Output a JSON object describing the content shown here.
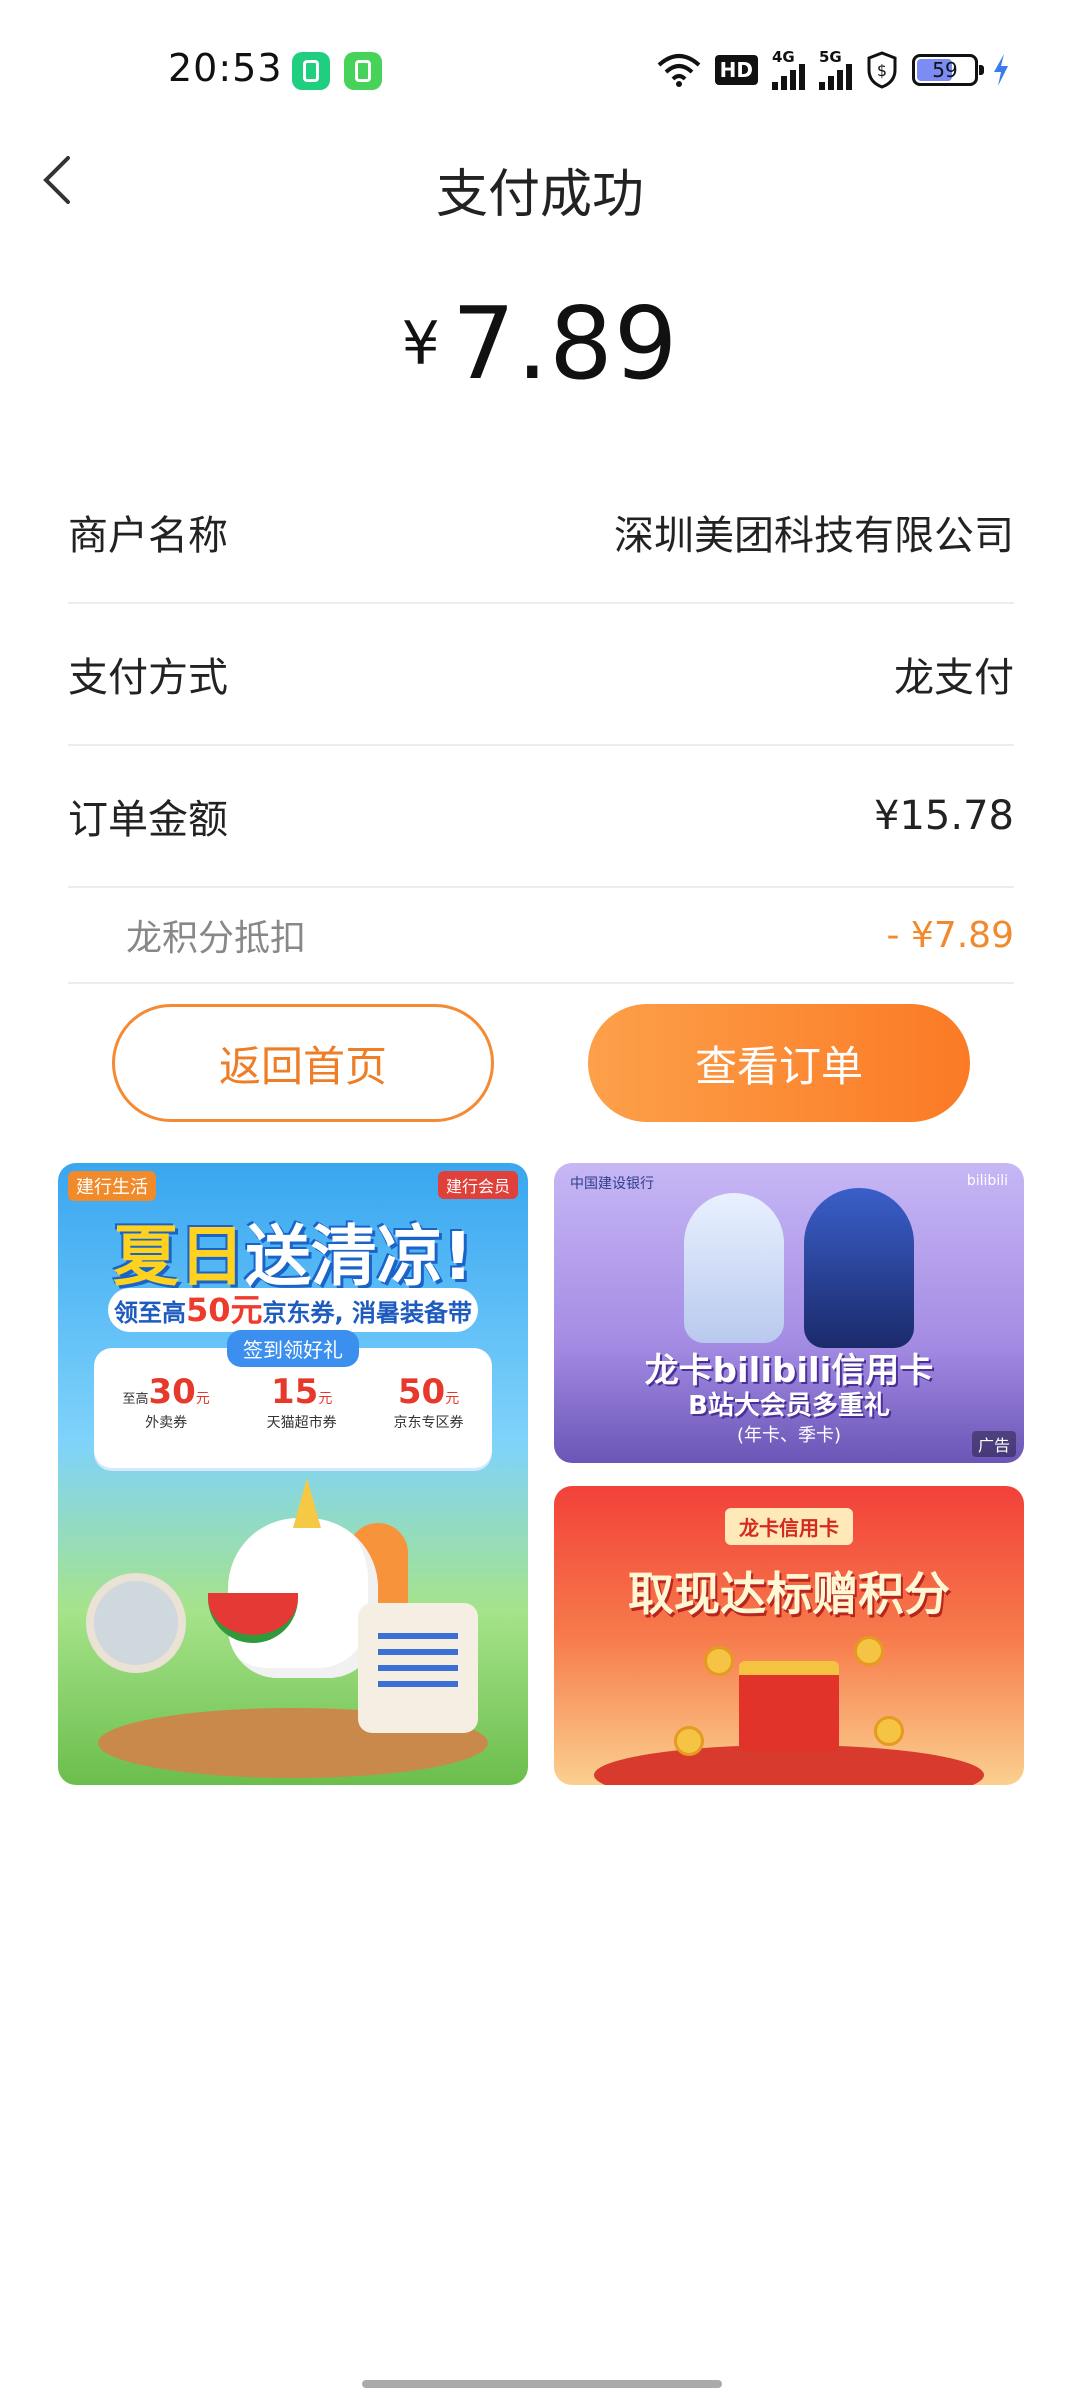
{
  "status_bar": {
    "time": "20:53",
    "network_badge": "HD",
    "signal1_label": "4G",
    "signal2_label": "5G",
    "battery": "59"
  },
  "header": {
    "title": "支付成功"
  },
  "amount": {
    "currency": "¥",
    "value": "7.89"
  },
  "details": [
    {
      "label": "商户名称",
      "value": "深圳美团科技有限公司"
    },
    {
      "label": "支付方式",
      "value": "龙支付"
    },
    {
      "label": "订单金额",
      "value": "¥15.78"
    }
  ],
  "deduction": {
    "label": "龙积分抵扣",
    "value": "- ¥7.89"
  },
  "buttons": {
    "home": "返回首页",
    "order": "查看订单"
  },
  "ads": {
    "summer": {
      "brand": "建行生活",
      "brand2": "建行会员",
      "title_part1": "夏日",
      "title_part2": "送清凉!",
      "subtitle_pre": "领至高",
      "subtitle_amount": "50元",
      "subtitle_post": "京东券, 消暑装备带回家",
      "sign_tag": "签到领好礼",
      "coupons": [
        {
          "pre": "至高",
          "num": "30",
          "unit": "元",
          "label": "外卖券"
        },
        {
          "pre": "",
          "num": "15",
          "unit": "元",
          "label": "天猫超市券"
        },
        {
          "pre": "",
          "num": "50",
          "unit": "元",
          "label": "京东专区券"
        }
      ]
    },
    "bili": {
      "bank": "中国建设银行",
      "logo": "bilibili",
      "title": "龙卡bilibili信用卡",
      "subtitle": "B站大会员多重礼",
      "subtitle2": "(年卡、季卡)",
      "ad_label": "广告"
    },
    "cash": {
      "tag": "龙卡信用卡",
      "title": "取现达标赠积分"
    }
  }
}
